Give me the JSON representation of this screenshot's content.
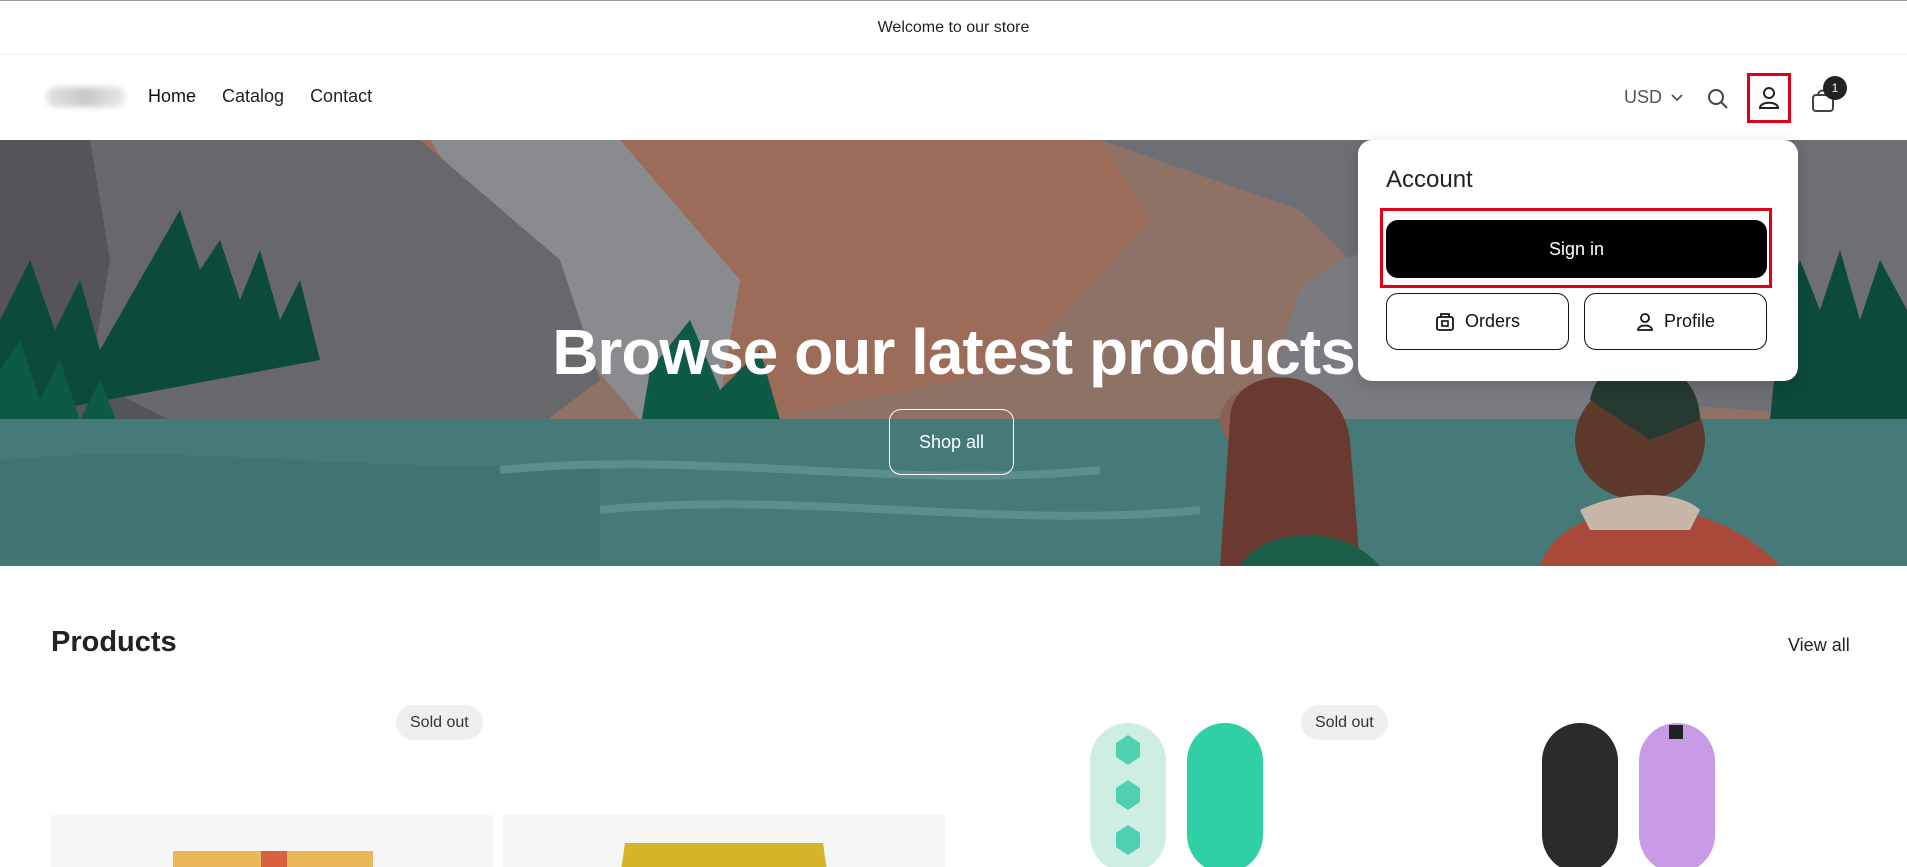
{
  "announcement": "Welcome to our store",
  "nav": {
    "items": [
      "Home",
      "Catalog",
      "Contact"
    ]
  },
  "header": {
    "currency": "USD",
    "cart_count": "1",
    "icons": [
      "search-icon",
      "account-icon",
      "cart-icon",
      "chevron-down-icon"
    ]
  },
  "hero": {
    "title": "Browse our latest products",
    "cta": "Shop all"
  },
  "account_menu": {
    "title": "Account",
    "sign_in": "Sign in",
    "orders": "Orders",
    "profile": "Profile"
  },
  "products": {
    "title": "Products",
    "view_all": "View all",
    "badges": [
      "Sold out",
      "Sold out"
    ]
  },
  "colors": {
    "highlight": "#e0001b",
    "primary_button": "#000000",
    "badge_bg": "#efefef"
  }
}
